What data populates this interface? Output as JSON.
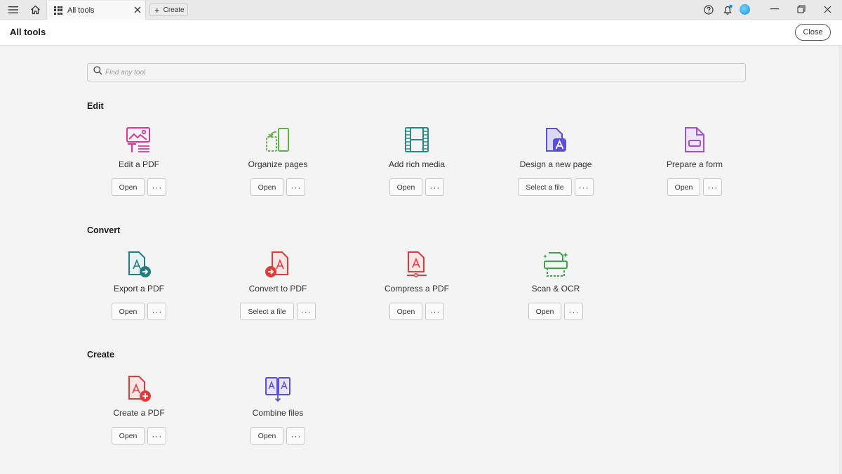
{
  "titlebar": {
    "tab_label": "All tools",
    "create_label": "Create",
    "accent_color": "#1c8fd6"
  },
  "header": {
    "title": "All tools",
    "close_label": "Close"
  },
  "search": {
    "placeholder": "Find any tool"
  },
  "sections": {
    "edit": {
      "title": "Edit",
      "tools": [
        {
          "label": "Edit a PDF",
          "button": "Open",
          "icon": "edit-pdf-icon",
          "color": "#d63b8f"
        },
        {
          "label": "Organize pages",
          "button": "Open",
          "icon": "organize-pages-icon",
          "color": "#5fb346"
        },
        {
          "label": "Add rich media",
          "button": "Open",
          "icon": "rich-media-icon",
          "color": "#2a8a8a"
        },
        {
          "label": "Design a new page",
          "button": "Select a file",
          "icon": "design-page-icon",
          "color": "#5b4fd6"
        },
        {
          "label": "Prepare a form",
          "button": "Open",
          "icon": "prepare-form-icon",
          "color": "#9a55c9"
        }
      ]
    },
    "convert": {
      "title": "Convert",
      "tools": [
        {
          "label": "Export a PDF",
          "button": "Open",
          "icon": "export-pdf-icon",
          "color": "#1f7e80"
        },
        {
          "label": "Convert to PDF",
          "button": "Select a file",
          "icon": "convert-pdf-icon",
          "color": "#e03b3b"
        },
        {
          "label": "Compress a PDF",
          "button": "Open",
          "icon": "compress-pdf-icon",
          "color": "#e03b3b"
        },
        {
          "label": "Scan & OCR",
          "button": "Open",
          "icon": "scan-ocr-icon",
          "color": "#3aa64a"
        }
      ]
    },
    "create": {
      "title": "Create",
      "tools": [
        {
          "label": "Create a PDF",
          "button": "Open",
          "icon": "create-pdf-icon",
          "color": "#e03b3b"
        },
        {
          "label": "Combine files",
          "button": "Open",
          "icon": "combine-files-icon",
          "color": "#5b4fd6"
        }
      ]
    }
  },
  "more_label": "···"
}
